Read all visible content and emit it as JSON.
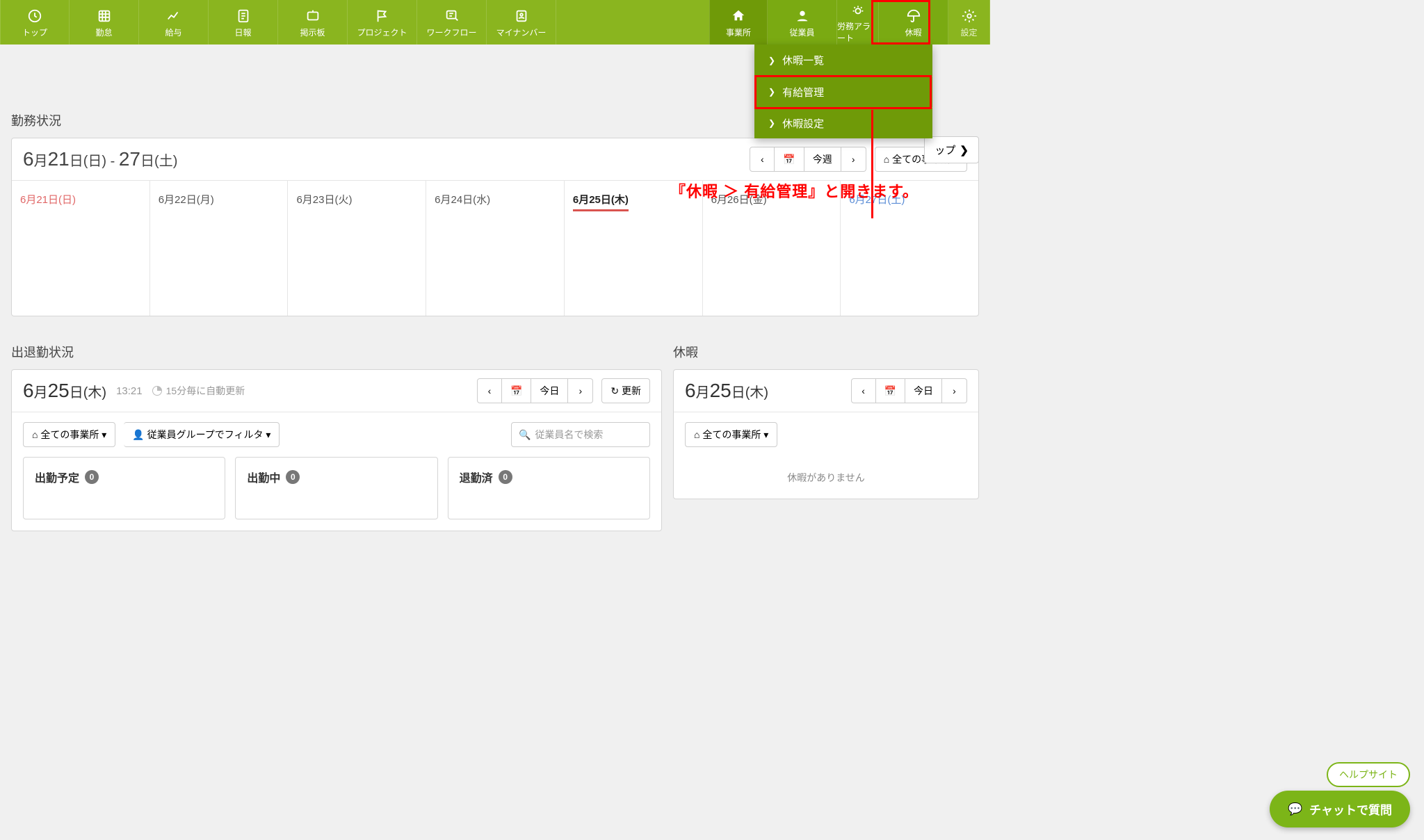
{
  "nav_left": [
    {
      "id": "top",
      "label": "トップ",
      "icon": "clock"
    },
    {
      "id": "kintai",
      "label": "勤怠",
      "icon": "grid"
    },
    {
      "id": "kyuyo",
      "label": "給与",
      "icon": "chart"
    },
    {
      "id": "nippo",
      "label": "日報",
      "icon": "note"
    },
    {
      "id": "keiji",
      "label": "掲示板",
      "icon": "board"
    },
    {
      "id": "project",
      "label": "プロジェクト",
      "icon": "flag"
    },
    {
      "id": "workflow",
      "label": "ワークフロー",
      "icon": "wf"
    },
    {
      "id": "mynumber",
      "label": "マイナンバー",
      "icon": "person"
    }
  ],
  "nav_right": [
    {
      "id": "office",
      "label": "事業所",
      "icon": "home",
      "cls": "dark office"
    },
    {
      "id": "employee",
      "label": "従業員",
      "icon": "user",
      "cls": "dark2"
    },
    {
      "id": "alert",
      "label": "労務アラート",
      "icon": "alert",
      "cls": "dark2",
      "w": "narrow"
    },
    {
      "id": "vacation",
      "label": "休暇",
      "icon": "umbrella",
      "cls": "dark2"
    },
    {
      "id": "settings",
      "label": "設定",
      "icon": "gear",
      "cls": "dim narrow"
    }
  ],
  "dropdown": [
    "休暇一覧",
    "有給管理",
    "休暇設定"
  ],
  "topbtn": "ップ",
  "annotation": "『休暇 ＞ 有給管理』と開きます。",
  "kinmu": {
    "title": "勤務状況",
    "range_html": {
      "m1": "6",
      "d1": "21",
      "w1": "日",
      "d2": "27",
      "w2": "土",
      "sep": " - "
    },
    "this_week": "今週",
    "office_sel": "全ての事業所",
    "days": [
      {
        "label": "6月21日(日)",
        "cls": "sun"
      },
      {
        "label": "6月22日(月)",
        "cls": ""
      },
      {
        "label": "6月23日(火)",
        "cls": ""
      },
      {
        "label": "6月24日(水)",
        "cls": ""
      },
      {
        "label": "6月25日(木)",
        "cls": "today"
      },
      {
        "label": "6月26日(金)",
        "cls": ""
      },
      {
        "label": "6月27日(土)",
        "cls": "sat"
      }
    ]
  },
  "att": {
    "title": "出退勤状況",
    "date": {
      "m": "6",
      "d": "25",
      "w": "木"
    },
    "time": "13:21",
    "auto": "15分毎に自動更新",
    "today": "今日",
    "update": "更新",
    "office": "全ての事業所",
    "group": "従業員グループでフィルタ",
    "search_ph": "従業員名で検索",
    "cards": [
      {
        "t": "出勤予定",
        "n": "0"
      },
      {
        "t": "出勤中",
        "n": "0"
      },
      {
        "t": "退勤済",
        "n": "0"
      }
    ]
  },
  "vac": {
    "title": "休暇",
    "date": {
      "m": "6",
      "d": "25",
      "w": "木"
    },
    "today": "今日",
    "office": "全ての事業所",
    "none": "休暇がありません"
  },
  "help": "ヘルプサイト",
  "chat": "チャットで質問"
}
